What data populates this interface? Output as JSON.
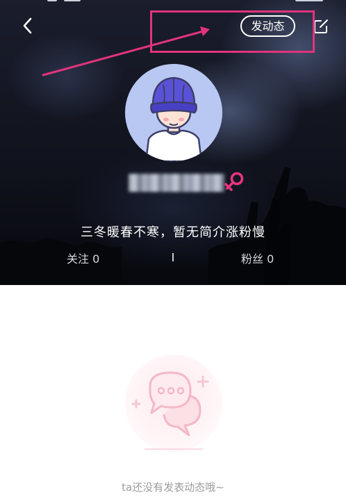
{
  "header": {
    "post_button_label": "发动态",
    "username": "",
    "bio": "三冬暖春不寒，暂无简介涨粉慢",
    "following_label": "关注",
    "following_count": "0",
    "fans_label": "粉丝",
    "fans_count": "0"
  },
  "icons": {
    "back": "chevron-left-icon",
    "edit": "edit-icon",
    "gender": "female-icon",
    "empty_state": "chat-bubbles-icon"
  },
  "annotation": {
    "color": "#e2347d"
  },
  "colors": {
    "gender_accent": "#e8337d",
    "avatar_bg": "#b9c8f2",
    "cap": "#5a52d6",
    "empty_text": "#9c9c9c"
  },
  "empty_state": {
    "message": "ta还没有发表动态哦~"
  }
}
